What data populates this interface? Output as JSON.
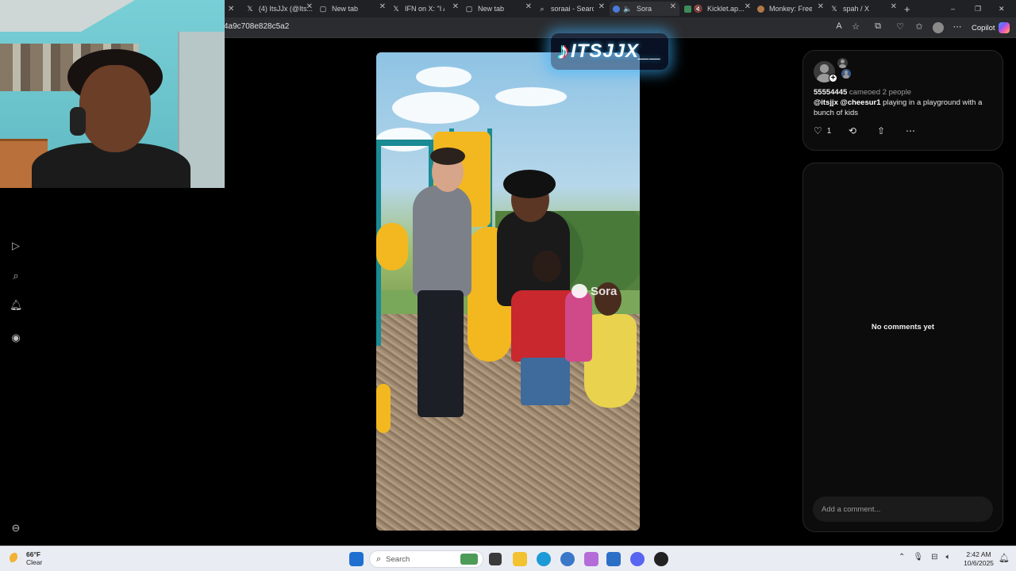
{
  "browser": {
    "tabs": [
      {
        "label": "(4) ItsJJx (@Its...",
        "icon": "x-logo-icon"
      },
      {
        "label": "New tab",
        "icon": "page-icon"
      },
      {
        "label": "IFN on X: \"I A...",
        "icon": "x-logo-icon"
      },
      {
        "label": "New tab",
        "icon": "page-icon"
      },
      {
        "label": "soraai - Search",
        "icon": "search-icon"
      },
      {
        "label": "Sora",
        "icon": "sora-icon",
        "muted": true
      },
      {
        "label": "Kicklet.ap...",
        "icon": "kicklet-icon",
        "muted": true
      },
      {
        "label": "Monkey: Free...",
        "icon": "monkey-icon"
      },
      {
        "label": "spah / X",
        "icon": "x-logo-icon"
      }
    ],
    "new_tab": "+",
    "url": "4a9c708e828c5a2",
    "copilot_label": "Copilot"
  },
  "watermark": {
    "platform_icon": "tiktok-logo-icon",
    "handle": "ITSJJX__"
  },
  "video": {
    "watermark": "Sora"
  },
  "post": {
    "user_id": "55554445",
    "cameo_text": "cameoed 2 people",
    "caption_mentions": "@itsjjx @cheesur1",
    "caption_text": " playing in a playground with a bunch of kids",
    "likes": "1"
  },
  "comments": {
    "empty_text": "No comments yet",
    "input_placeholder": "Add a comment..."
  },
  "taskbar": {
    "weather_temp": "66°F",
    "weather_desc": "Clear",
    "search_label": "Search",
    "time": "2:42 AM",
    "date": "10/6/2025",
    "apps": [
      {
        "name": "windows-start-icon",
        "color": "#1f6fd1"
      },
      {
        "name": "task-view-icon",
        "color": "#3a3a3a"
      },
      {
        "name": "file-explorer-icon",
        "color": "#f2c230"
      },
      {
        "name": "edge-icon",
        "color": "#1c9ad8"
      },
      {
        "name": "app-icon",
        "color": "#3b77c9"
      },
      {
        "name": "app-icon",
        "color": "#b46cd9"
      },
      {
        "name": "store-icon",
        "color": "#2c6fc7"
      },
      {
        "name": "discord-icon",
        "color": "#5865f2"
      },
      {
        "name": "obs-icon",
        "color": "#222222"
      }
    ]
  }
}
